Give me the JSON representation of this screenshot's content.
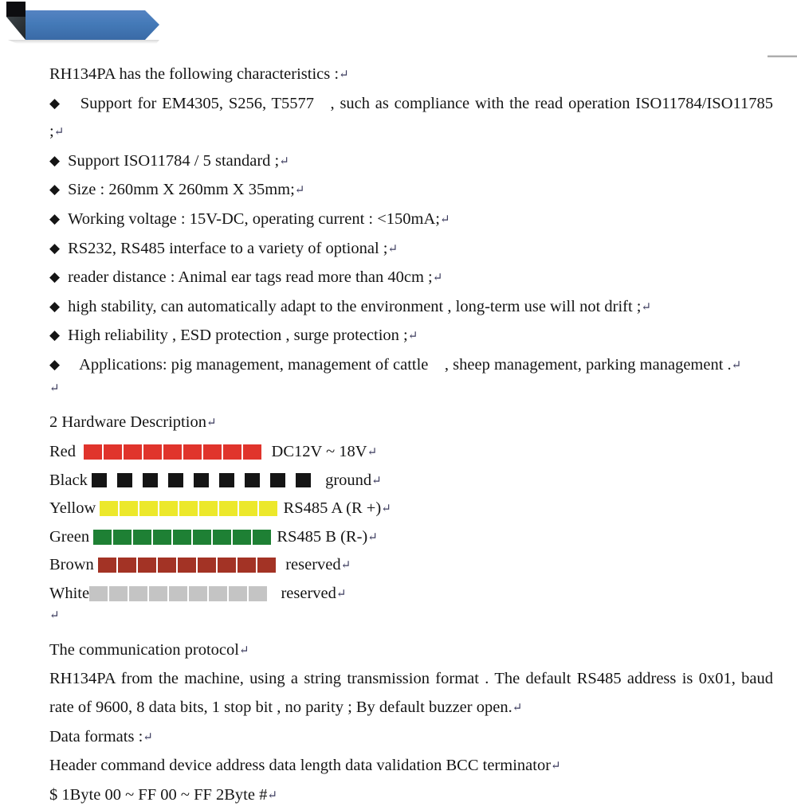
{
  "banner": {
    "icon": "right-arrow-banner",
    "blue": "#3f72b5",
    "dark_triangle": "#2e3438",
    "black_square": "#0d0d10"
  },
  "rule": {
    "color": "#9a9a9a"
  },
  "document": {
    "intro": "RH134PA has the following characteristics :",
    "bullet_glyph": "◆",
    "cr_glyph": "↵",
    "bullets": [
      "Support for EM4305, S256, T5577 , such as compliance with the read operation ISO11784/ISO11785 ;",
      "Support ISO11784 / 5 standard ;",
      "Size : 260mm X 260mm X 35mm;",
      "Working voltage : 15V-DC, operating current : <150mA;",
      "RS232, RS485 interface to a variety of optional ;",
      "reader distance : Animal ear tags read more than 40cm ;",
      "high stability, can automatically adapt to the environment , long-term use will not drift ;",
      "High reliability , ESD protection , surge protection ;",
      "Applications: pig management, management of cattle , sheep management, parking management ."
    ],
    "justified_bullets": [
      0,
      8
    ],
    "section_hardware": "2 Hardware Description",
    "wires": [
      {
        "name": "Red",
        "color": "#e0342c",
        "count": 9,
        "desc": "DC12V ~ 18V",
        "name_pad": "Red  ",
        "desc_pad": "  DC12V ~ 18V"
      },
      {
        "name": "Black",
        "color": "#151515",
        "count": 9,
        "desc": "ground",
        "name_pad": "Black ",
        "desc_pad": " ground"
      },
      {
        "name": "Yellow",
        "color": "#ece82b",
        "count": 9,
        "desc": "RS485 A (R +)",
        "name_pad": "Yellow ",
        "desc_pad": " RS485 A (R +)"
      },
      {
        "name": "Green",
        "color": "#1e8034",
        "count": 9,
        "desc": "RS485 B (R-)",
        "name_pad": "Green ",
        "desc_pad": " RS485 B (R-)"
      },
      {
        "name": "Brown",
        "color": "#a33325",
        "count": 9,
        "desc": "reserved",
        "name_pad": "Brown ",
        "desc_pad": "  reserved"
      },
      {
        "name": "White",
        "color": "#c4c4c4",
        "count": 9,
        "desc": "reserved",
        "name_pad": "White",
        "desc_pad": "   reserved"
      }
    ],
    "protocol_heading": "The communication protocol",
    "protocol_body": "RH134PA from the machine, using a string transmission format . The default RS485 address is 0x01, baud rate of 9600, 8 data bits, 1 stop bit , no parity ; By default buzzer open.",
    "data_formats_label": "Data formats :",
    "data_format_header": "Header command device address data length data validation BCC terminator",
    "data_format_values": "$ 1Byte 00 ~ FF 00 ~ FF 2Byte #"
  }
}
